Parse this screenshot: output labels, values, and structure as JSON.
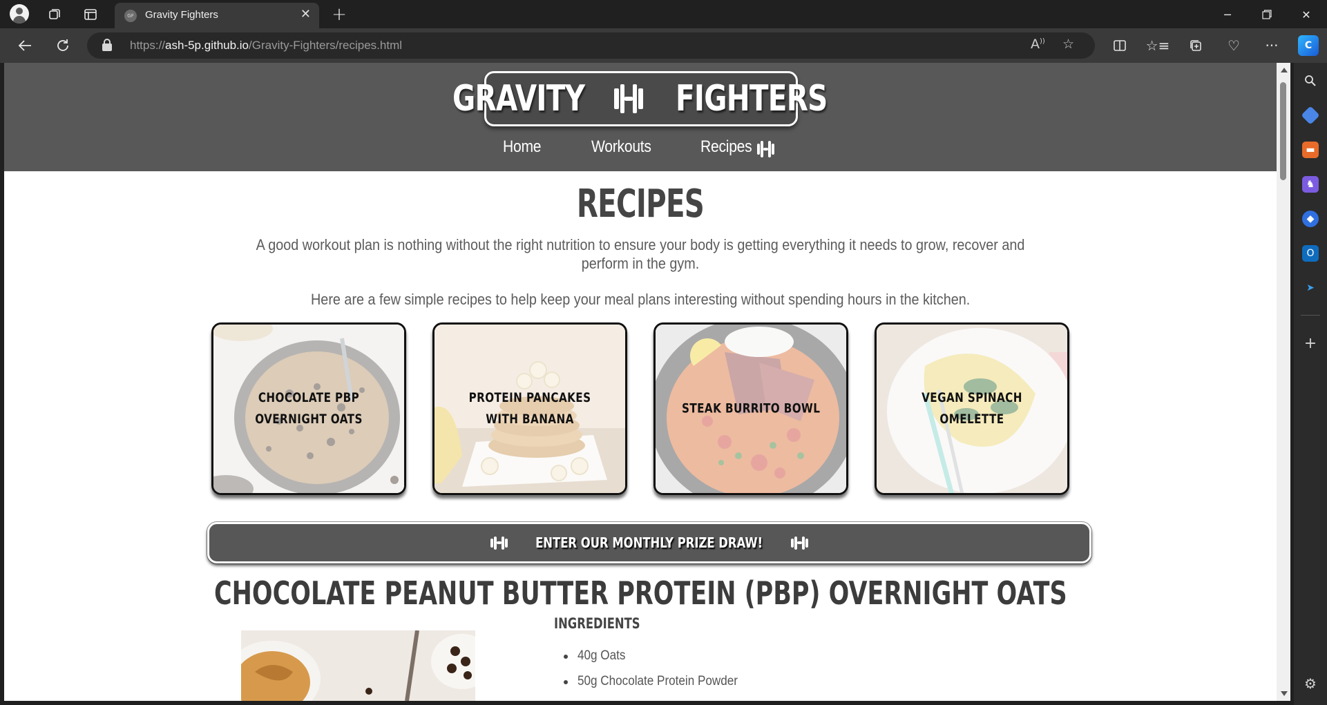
{
  "browser": {
    "tab_title": "Gravity Fighters",
    "favicon_text": "GF",
    "url_prefix": "https://",
    "url_host": "ash-5p.github.io",
    "url_path": "/Gravity-Fighters/recipes.html"
  },
  "site": {
    "logo_left": "GRAVITY",
    "logo_right": "FIGHTERS",
    "nav": [
      {
        "label": "Home"
      },
      {
        "label": "Workouts"
      },
      {
        "label": "Recipes"
      }
    ]
  },
  "page": {
    "title": "RECIPES",
    "intro_1": "A good workout plan is nothing without the right nutrition to ensure your body is getting everything it needs to grow, recover and perform in the gym.",
    "intro_2": "Here are a few simple recipes to help keep your meal plans interesting without spending hours in the kitchen.",
    "recipe_cards": [
      {
        "label": "CHOCOLATE PBP OVERNIGHT OATS"
      },
      {
        "label": "PROTEIN PANCAKES WITH BANANA"
      },
      {
        "label": "STEAK BURRITO BOWL"
      },
      {
        "label": "VEGAN SPINACH OMELETTE"
      }
    ],
    "prize_button": "ENTER OUR MONTHLY PRIZE DRAW!",
    "recipe": {
      "title": "CHOCOLATE PEANUT BUTTER PROTEIN (PBP) OVERNIGHT OATS",
      "ingredients_heading": "INGREDIENTS",
      "ingredients": [
        "40g Oats",
        "50g Chocolate Protein Powder"
      ]
    }
  },
  "colors": {
    "header_bg": "#585858",
    "title_text": "#454545",
    "button_bg": "#575757"
  }
}
